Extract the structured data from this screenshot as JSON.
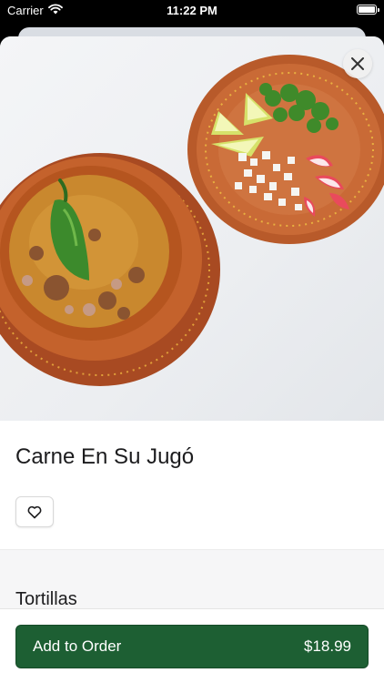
{
  "status_bar": {
    "carrier": "Carrier",
    "time": "11:22 PM",
    "battery_level": 1.0
  },
  "item": {
    "title": "Carne En Su Jugó",
    "image_icon": "food-photo"
  },
  "actions": {
    "close_icon": "close-icon",
    "favorite_icon": "heart-icon"
  },
  "section": {
    "title": "Tortillas"
  },
  "order": {
    "label": "Add to Order",
    "price": "$18.99",
    "button_color": "#1d5f33"
  }
}
